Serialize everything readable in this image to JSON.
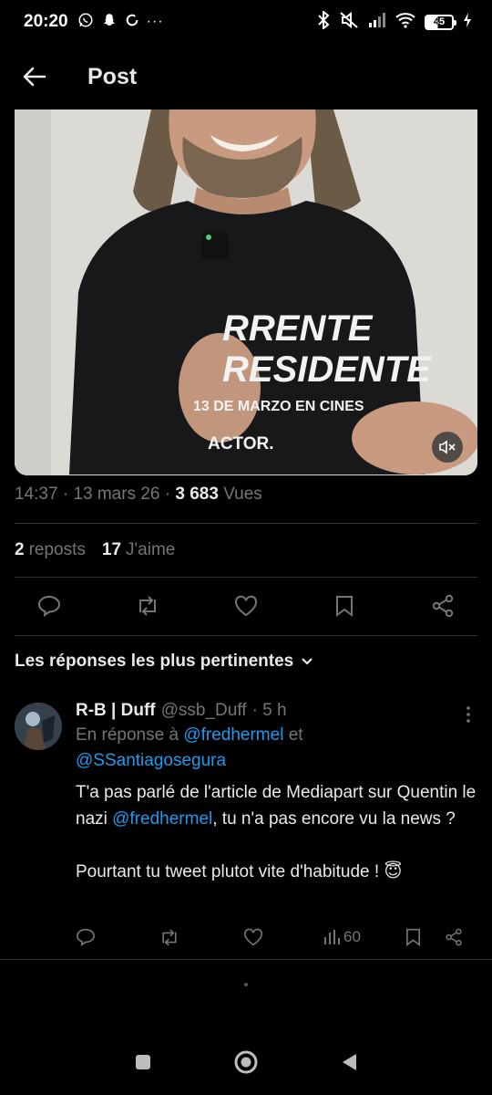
{
  "status_bar": {
    "time": "20:20",
    "battery": "45"
  },
  "header": {
    "title": "Post"
  },
  "media": {
    "shirt_line1": "RRENTE",
    "shirt_line2": "RESIDENTE",
    "shirt_line3": "13 DE MARZO EN CINES",
    "shirt_line4": "ACTOR."
  },
  "post_meta": {
    "time": "14:37",
    "separator": "·",
    "date": "13 mars 26",
    "views_count": "3 683",
    "views_label": "Vues"
  },
  "stats": {
    "reposts_count": "2",
    "reposts_label": "reposts",
    "likes_count": "17",
    "likes_label": "J'aime"
  },
  "sort": {
    "label": "Les réponses les plus pertinentes"
  },
  "reply": {
    "name": "R-B | Duff",
    "handle": "@ssb_Duff",
    "time": "· 5 h",
    "reply_to_prefix": "En réponse à",
    "reply_to_user1": "@fredhermel",
    "reply_to_and": "et",
    "reply_to_user2": "@SSantiagosegura",
    "text_part1": "T'a pas parlé de l'article de Mediapart sur Quentin le nazi",
    "text_mention": "@fredhermel",
    "text_part2": ", tu n'a pas encore vu la news ?",
    "text_line2": "Pourtant tu tweet plutot vite d'habitude !",
    "emoji": "😇",
    "views": "60"
  },
  "colors": {
    "background": "#000000",
    "text_primary": "#e7e9ea",
    "text_secondary": "#71767b",
    "accent": "#1d9bf0",
    "divider": "#2f3336"
  }
}
